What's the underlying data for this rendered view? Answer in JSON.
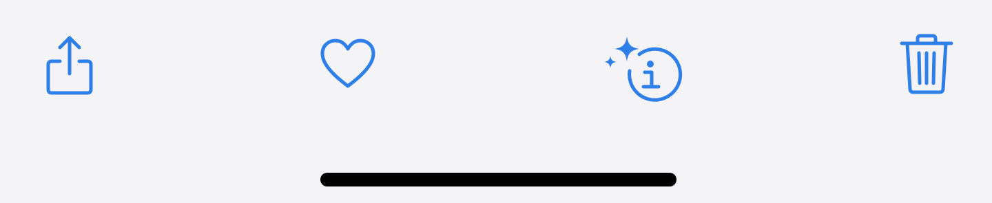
{
  "colors": {
    "background": "#f4f4f7",
    "accent": "#2f7fe9",
    "home_indicator": "#000000"
  },
  "toolbar": {
    "buttons": [
      {
        "id": "share",
        "icon": "share-icon"
      },
      {
        "id": "favorite",
        "icon": "heart-icon"
      },
      {
        "id": "info",
        "icon": "sparkle-info-icon"
      },
      {
        "id": "delete",
        "icon": "trash-icon"
      }
    ]
  },
  "home_indicator": {
    "icon": "home-indicator-bar"
  }
}
